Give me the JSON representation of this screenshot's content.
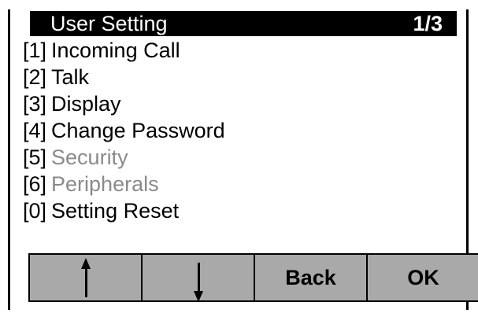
{
  "header": {
    "title": "User Setting",
    "page_indicator": "1/3"
  },
  "menu": {
    "items": [
      {
        "key": "[1]",
        "label": "Incoming Call",
        "enabled": true
      },
      {
        "key": "[2]",
        "label": "Talk",
        "enabled": true
      },
      {
        "key": "[3]",
        "label": "Display",
        "enabled": true
      },
      {
        "key": "[4]",
        "label": "Change Password",
        "enabled": true
      },
      {
        "key": "[5]",
        "label": "Security",
        "enabled": false
      },
      {
        "key": "[6]",
        "label": "Peripherals",
        "enabled": false
      },
      {
        "key": "[0]",
        "label": "Setting Reset",
        "enabled": true
      }
    ]
  },
  "softkeys": {
    "up_icon": "arrow-up-icon",
    "down_icon": "arrow-down-icon",
    "back_label": "Back",
    "ok_label": "OK"
  },
  "colors": {
    "title_bar_bg": "#000000",
    "title_bar_text": "#ffffff",
    "softkey_bg": "#a9a9a9",
    "disabled_text": "#8a8a8a"
  }
}
